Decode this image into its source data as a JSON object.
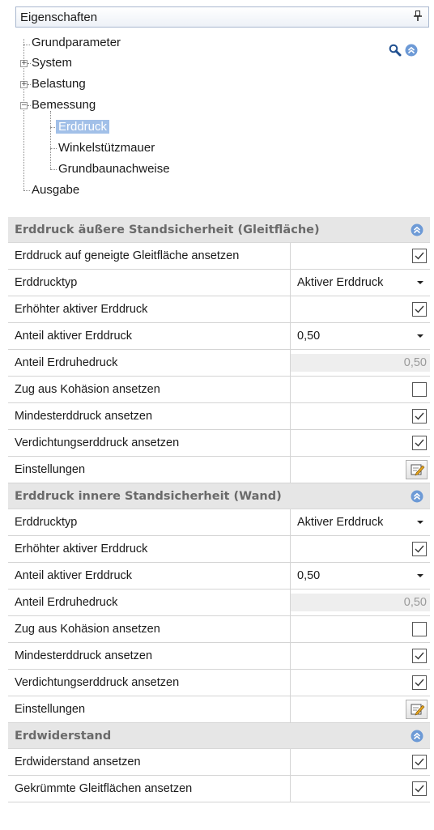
{
  "panel": {
    "title": "Eigenschaften",
    "pin_icon": "pin-icon"
  },
  "tree": {
    "items": [
      {
        "label": "Grundparameter"
      },
      {
        "label": "System"
      },
      {
        "label": "Belastung"
      },
      {
        "label": "Bemessung"
      },
      {
        "label": "Erddruck"
      },
      {
        "label": "Winkelstützmauer"
      },
      {
        "label": "Grundbaunachweise"
      },
      {
        "label": "Ausgabe"
      }
    ],
    "search_icon": "search-icon",
    "collapse_icon": "collapse-up-icon"
  },
  "sections": [
    {
      "title": "Erddruck äußere Standsicherheit (Gleitfläche)",
      "rows": [
        {
          "name": "Erddruck auf geneigte Gleitfläche ansetzen",
          "type": "checkbox",
          "checked": true
        },
        {
          "name": "Erddrucktyp",
          "type": "dropdown",
          "value": "Aktiver Erddruck"
        },
        {
          "name": "Erhöhter aktiver Erddruck",
          "type": "checkbox",
          "checked": true
        },
        {
          "name": "Anteil aktiver Erddruck",
          "type": "dropdown",
          "value": "0,50"
        },
        {
          "name": "Anteil Erdruhedruck",
          "type": "readonly",
          "value": "0,50"
        },
        {
          "name": "Zug aus Kohäsion ansetzen",
          "type": "checkbox",
          "checked": false
        },
        {
          "name": "Mindesterddruck ansetzen",
          "type": "checkbox",
          "checked": true
        },
        {
          "name": "Verdichtungserddruck ansetzen",
          "type": "checkbox",
          "checked": true
        },
        {
          "name": "Einstellungen",
          "type": "button"
        }
      ]
    },
    {
      "title": "Erddruck innere Standsicherheit (Wand)",
      "rows": [
        {
          "name": "Erddrucktyp",
          "type": "dropdown",
          "value": "Aktiver Erddruck"
        },
        {
          "name": "Erhöhter aktiver Erddruck",
          "type": "checkbox",
          "checked": true
        },
        {
          "name": "Anteil aktiver Erddruck",
          "type": "dropdown",
          "value": "0,50"
        },
        {
          "name": "Anteil Erdruhedruck",
          "type": "readonly",
          "value": "0,50"
        },
        {
          "name": "Zug aus Kohäsion ansetzen",
          "type": "checkbox",
          "checked": false
        },
        {
          "name": "Mindesterddruck ansetzen",
          "type": "checkbox",
          "checked": true
        },
        {
          "name": "Verdichtungserddruck ansetzen",
          "type": "checkbox",
          "checked": true
        },
        {
          "name": "Einstellungen",
          "type": "button"
        }
      ]
    },
    {
      "title": "Erdwiderstand",
      "rows": [
        {
          "name": "Erdwiderstand ansetzen",
          "type": "checkbox",
          "checked": true
        },
        {
          "name": "Gekrümmte Gleitflächen ansetzen",
          "type": "checkbox",
          "checked": true
        }
      ]
    }
  ],
  "colors": {
    "accent": "#6d9ad6",
    "selection": "#a2c0e8",
    "section_bg": "#e6e6e6"
  }
}
